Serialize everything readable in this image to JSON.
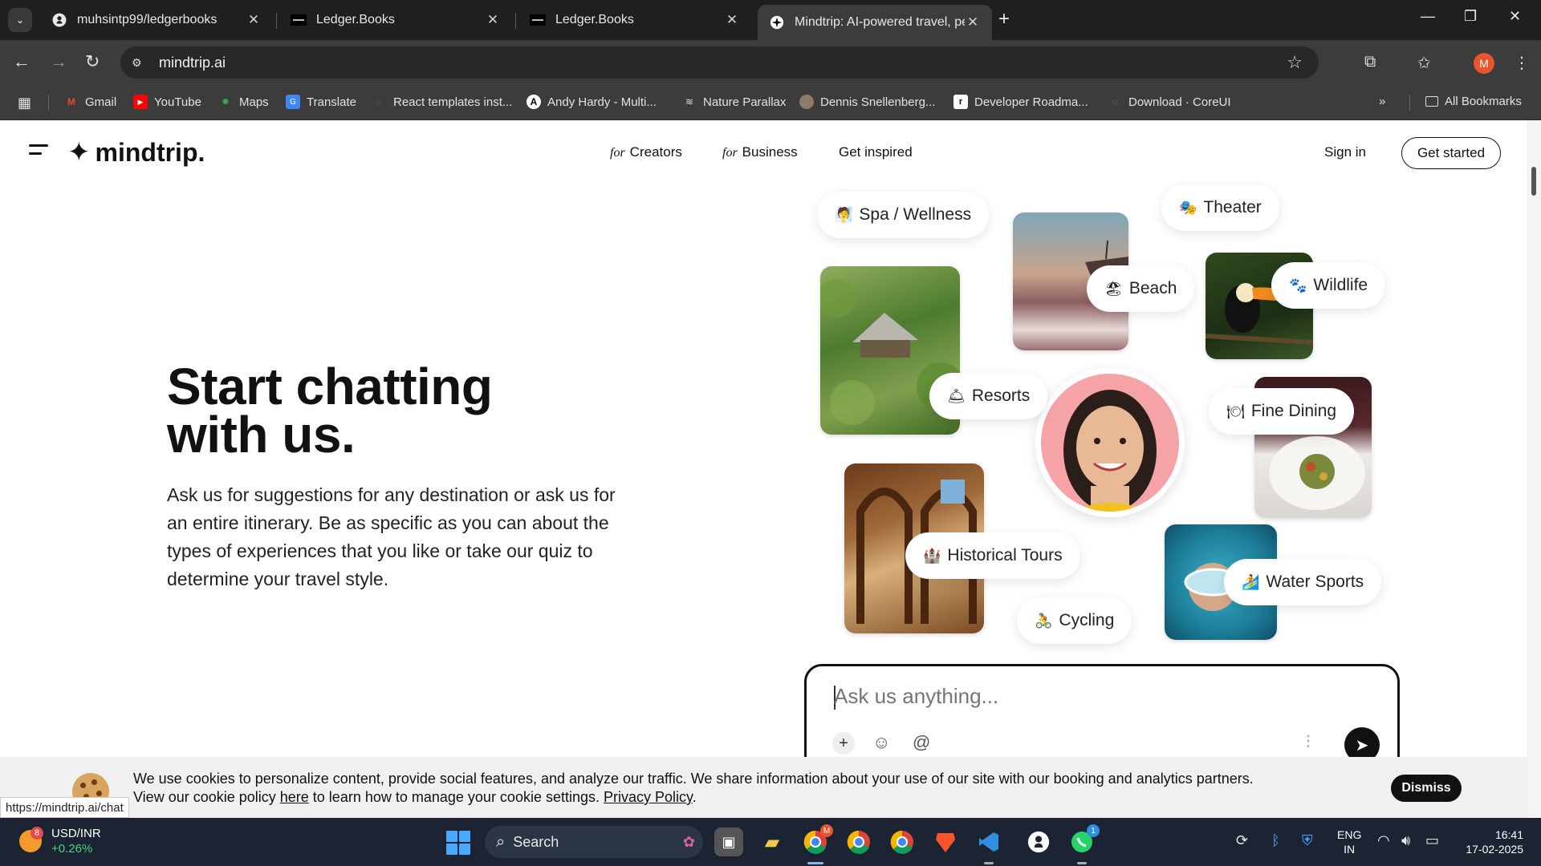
{
  "browser": {
    "tabs": [
      {
        "title": "muhsintp99/ledgerbooks",
        "icon": "github-icon",
        "active": false
      },
      {
        "title": "Ledger.Books",
        "icon": "ledger-icon",
        "active": false
      },
      {
        "title": "Ledger.Books",
        "icon": "ledger-icon",
        "active": false
      },
      {
        "title": "Mindtrip: AI-powered travel, pe",
        "icon": "mindtrip-icon",
        "active": true
      }
    ],
    "url": "mindtrip.ai",
    "profile_initial": "M",
    "bookmarks": [
      {
        "label": "Gmail",
        "icon": "gmail-icon"
      },
      {
        "label": "YouTube",
        "icon": "youtube-icon"
      },
      {
        "label": "Maps",
        "icon": "maps-icon"
      },
      {
        "label": "Translate",
        "icon": "translate-icon"
      },
      {
        "label": "React templates inst...",
        "icon": "globe-icon"
      },
      {
        "label": "Andy Hardy - Multi...",
        "icon": "andy-hardy-icon"
      },
      {
        "label": "Nature Parallax",
        "icon": "parallax-icon"
      },
      {
        "label": "Dennis Snellenberg...",
        "icon": "dennis-avatar-icon"
      },
      {
        "label": "Developer Roadma...",
        "icon": "roadmap-icon"
      },
      {
        "label": "Download · CoreUI",
        "icon": "coreui-icon"
      }
    ],
    "all_bookmarks": "All Bookmarks",
    "status_url": "https://mindtrip.ai/chat"
  },
  "site": {
    "logo": "mindtrip.",
    "nav": [
      {
        "prefix": "for",
        "label": "Creators"
      },
      {
        "prefix": "for",
        "label": "Business"
      },
      {
        "prefix": "",
        "label": "Get inspired"
      }
    ],
    "sign_in": "Sign in",
    "get_started": "Get started"
  },
  "hero": {
    "title_line1": "Start chatting",
    "title_line2": "with us.",
    "description": "Ask us for suggestions for any destination or ask us for an entire itinerary. Be as specific as you can about the types of experiences that you like or take our quiz to determine your travel style."
  },
  "categories": [
    {
      "label": "Spa / Wellness",
      "emoji": "🧖"
    },
    {
      "label": "Theater",
      "emoji": "🎭"
    },
    {
      "label": "Beach",
      "emoji": "🏖"
    },
    {
      "label": "Wildlife",
      "emoji": "🐾"
    },
    {
      "label": "Resorts",
      "emoji": "🛎"
    },
    {
      "label": "Fine Dining",
      "emoji": "🍽"
    },
    {
      "label": "Historical Tours",
      "emoji": "🏰"
    },
    {
      "label": "Water Sports",
      "emoji": "🏄"
    },
    {
      "label": "Cycling",
      "emoji": "🚴"
    }
  ],
  "chat": {
    "placeholder": "Ask us anything..."
  },
  "cookie": {
    "line1": "We use cookies to personalize content, provide social features, and analyze our traffic. We share information about your use of our site with our booking and analytics partners.",
    "line2_pre": "View our cookie policy ",
    "here": "here",
    "line2_mid": " to learn how to manage your cookie settings. ",
    "privacy": "Privacy Policy",
    "line2_end": ".",
    "dismiss": "Dismiss"
  },
  "taskbar": {
    "widget_badge": "8",
    "widget_title": "USD/INR",
    "widget_change": "+0.26%",
    "search": "Search",
    "whatsapp_badge": "1",
    "chrome_badge": "M",
    "lang1": "ENG",
    "lang2": "IN",
    "time": "16:41",
    "date": "17-02-2025"
  }
}
